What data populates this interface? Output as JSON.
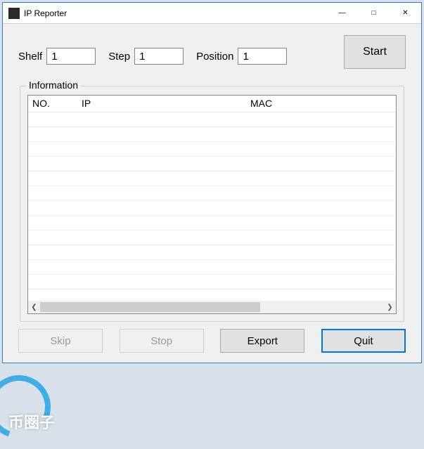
{
  "window": {
    "title": "IP Reporter"
  },
  "inputs": {
    "shelf_label": "Shelf",
    "shelf_value": "1",
    "step_label": "Step",
    "step_value": "1",
    "position_label": "Position",
    "position_value": "1"
  },
  "start_button": "Start",
  "group_label": "Information",
  "columns": {
    "no": "NO.",
    "ip": "IP",
    "mac": "MAC"
  },
  "rows": [],
  "buttons": {
    "skip": "Skip",
    "stop": "Stop",
    "export": "Export",
    "quit": "Quit"
  },
  "watermark": "币圈子"
}
